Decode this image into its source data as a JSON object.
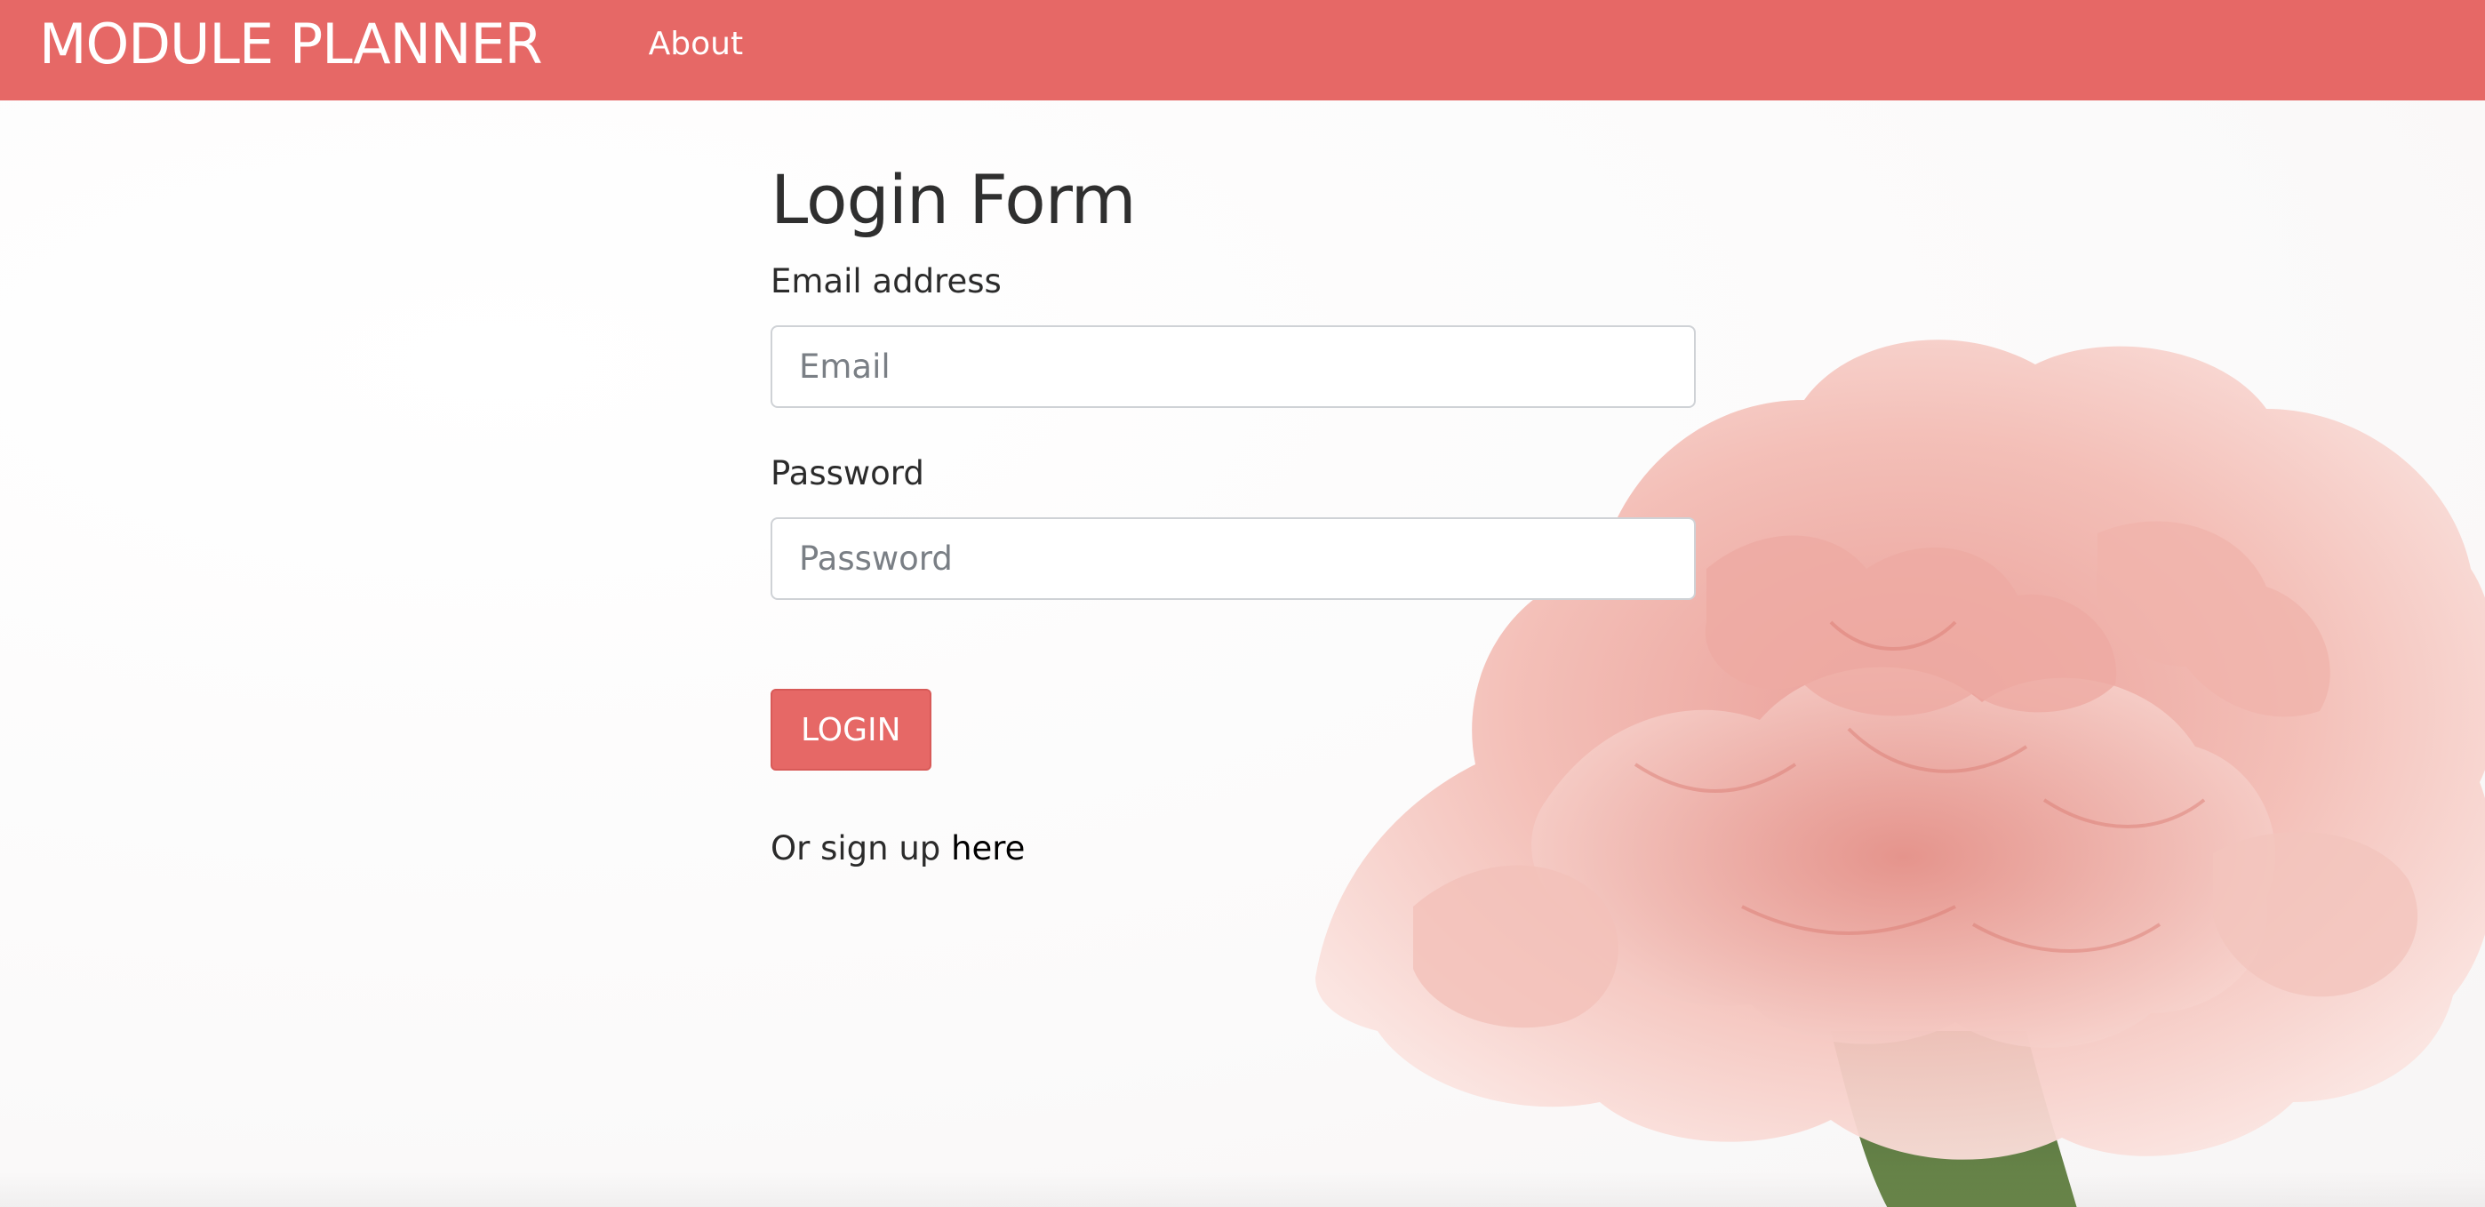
{
  "navbar": {
    "brand": "MODULE PLANNER",
    "links": [
      {
        "label": "About"
      }
    ],
    "background_color": "#e66866"
  },
  "form": {
    "title": "Login Form",
    "email": {
      "label": "Email address",
      "placeholder": "Email",
      "value": ""
    },
    "password": {
      "label": "Password",
      "placeholder": "Password",
      "value": ""
    },
    "submit_label": "LOGIN",
    "signup_prefix": "Or sign up ",
    "signup_link": "here"
  },
  "background": {
    "image": "pink-carnation-flower"
  },
  "colors": {
    "accent": "#e66866",
    "text": "#2b2b2b",
    "input_border": "#cfd2d6"
  }
}
